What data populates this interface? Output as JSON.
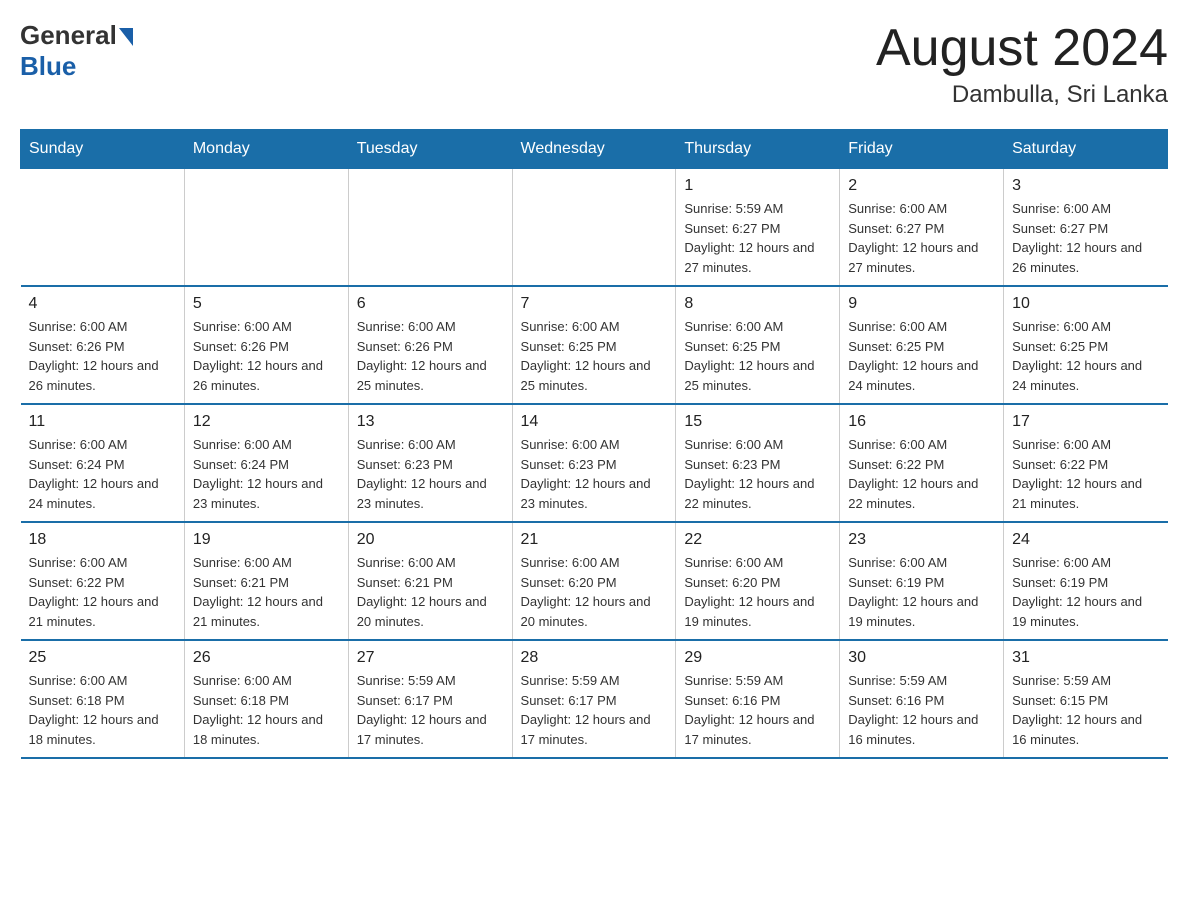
{
  "header": {
    "logo_general": "General",
    "logo_blue": "Blue",
    "month_title": "August 2024",
    "location": "Dambulla, Sri Lanka"
  },
  "days_of_week": [
    "Sunday",
    "Monday",
    "Tuesday",
    "Wednesday",
    "Thursday",
    "Friday",
    "Saturday"
  ],
  "weeks": [
    [
      {
        "day": "",
        "info": ""
      },
      {
        "day": "",
        "info": ""
      },
      {
        "day": "",
        "info": ""
      },
      {
        "day": "",
        "info": ""
      },
      {
        "day": "1",
        "info": "Sunrise: 5:59 AM\nSunset: 6:27 PM\nDaylight: 12 hours and 27 minutes."
      },
      {
        "day": "2",
        "info": "Sunrise: 6:00 AM\nSunset: 6:27 PM\nDaylight: 12 hours and 27 minutes."
      },
      {
        "day": "3",
        "info": "Sunrise: 6:00 AM\nSunset: 6:27 PM\nDaylight: 12 hours and 26 minutes."
      }
    ],
    [
      {
        "day": "4",
        "info": "Sunrise: 6:00 AM\nSunset: 6:26 PM\nDaylight: 12 hours and 26 minutes."
      },
      {
        "day": "5",
        "info": "Sunrise: 6:00 AM\nSunset: 6:26 PM\nDaylight: 12 hours and 26 minutes."
      },
      {
        "day": "6",
        "info": "Sunrise: 6:00 AM\nSunset: 6:26 PM\nDaylight: 12 hours and 25 minutes."
      },
      {
        "day": "7",
        "info": "Sunrise: 6:00 AM\nSunset: 6:25 PM\nDaylight: 12 hours and 25 minutes."
      },
      {
        "day": "8",
        "info": "Sunrise: 6:00 AM\nSunset: 6:25 PM\nDaylight: 12 hours and 25 minutes."
      },
      {
        "day": "9",
        "info": "Sunrise: 6:00 AM\nSunset: 6:25 PM\nDaylight: 12 hours and 24 minutes."
      },
      {
        "day": "10",
        "info": "Sunrise: 6:00 AM\nSunset: 6:25 PM\nDaylight: 12 hours and 24 minutes."
      }
    ],
    [
      {
        "day": "11",
        "info": "Sunrise: 6:00 AM\nSunset: 6:24 PM\nDaylight: 12 hours and 24 minutes."
      },
      {
        "day": "12",
        "info": "Sunrise: 6:00 AM\nSunset: 6:24 PM\nDaylight: 12 hours and 23 minutes."
      },
      {
        "day": "13",
        "info": "Sunrise: 6:00 AM\nSunset: 6:23 PM\nDaylight: 12 hours and 23 minutes."
      },
      {
        "day": "14",
        "info": "Sunrise: 6:00 AM\nSunset: 6:23 PM\nDaylight: 12 hours and 23 minutes."
      },
      {
        "day": "15",
        "info": "Sunrise: 6:00 AM\nSunset: 6:23 PM\nDaylight: 12 hours and 22 minutes."
      },
      {
        "day": "16",
        "info": "Sunrise: 6:00 AM\nSunset: 6:22 PM\nDaylight: 12 hours and 22 minutes."
      },
      {
        "day": "17",
        "info": "Sunrise: 6:00 AM\nSunset: 6:22 PM\nDaylight: 12 hours and 21 minutes."
      }
    ],
    [
      {
        "day": "18",
        "info": "Sunrise: 6:00 AM\nSunset: 6:22 PM\nDaylight: 12 hours and 21 minutes."
      },
      {
        "day": "19",
        "info": "Sunrise: 6:00 AM\nSunset: 6:21 PM\nDaylight: 12 hours and 21 minutes."
      },
      {
        "day": "20",
        "info": "Sunrise: 6:00 AM\nSunset: 6:21 PM\nDaylight: 12 hours and 20 minutes."
      },
      {
        "day": "21",
        "info": "Sunrise: 6:00 AM\nSunset: 6:20 PM\nDaylight: 12 hours and 20 minutes."
      },
      {
        "day": "22",
        "info": "Sunrise: 6:00 AM\nSunset: 6:20 PM\nDaylight: 12 hours and 19 minutes."
      },
      {
        "day": "23",
        "info": "Sunrise: 6:00 AM\nSunset: 6:19 PM\nDaylight: 12 hours and 19 minutes."
      },
      {
        "day": "24",
        "info": "Sunrise: 6:00 AM\nSunset: 6:19 PM\nDaylight: 12 hours and 19 minutes."
      }
    ],
    [
      {
        "day": "25",
        "info": "Sunrise: 6:00 AM\nSunset: 6:18 PM\nDaylight: 12 hours and 18 minutes."
      },
      {
        "day": "26",
        "info": "Sunrise: 6:00 AM\nSunset: 6:18 PM\nDaylight: 12 hours and 18 minutes."
      },
      {
        "day": "27",
        "info": "Sunrise: 5:59 AM\nSunset: 6:17 PM\nDaylight: 12 hours and 17 minutes."
      },
      {
        "day": "28",
        "info": "Sunrise: 5:59 AM\nSunset: 6:17 PM\nDaylight: 12 hours and 17 minutes."
      },
      {
        "day": "29",
        "info": "Sunrise: 5:59 AM\nSunset: 6:16 PM\nDaylight: 12 hours and 17 minutes."
      },
      {
        "day": "30",
        "info": "Sunrise: 5:59 AM\nSunset: 6:16 PM\nDaylight: 12 hours and 16 minutes."
      },
      {
        "day": "31",
        "info": "Sunrise: 5:59 AM\nSunset: 6:15 PM\nDaylight: 12 hours and 16 minutes."
      }
    ]
  ]
}
